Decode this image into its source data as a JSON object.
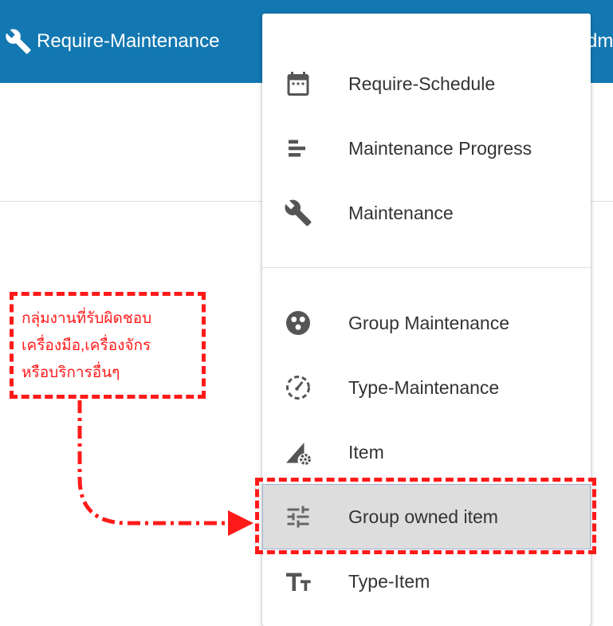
{
  "header": {
    "title": "Require-Maintenance",
    "title_icon": "wrench-icon",
    "user_label_fragment": "dm",
    "bg_color": "#1378b1"
  },
  "menu": {
    "items": [
      {
        "label": "Require-Schedule",
        "icon": "calendar-icon"
      },
      {
        "label": "Maintenance Progress",
        "icon": "bar-list-icon"
      },
      {
        "label": "Maintenance",
        "icon": "wrench-icon"
      },
      {
        "label": "Group Maintenance",
        "icon": "group-icon"
      },
      {
        "label": "Type-Maintenance",
        "icon": "dashed-gauge-icon"
      },
      {
        "label": "Item",
        "icon": "ruler-gear-icon"
      },
      {
        "label": "Group owned item",
        "icon": "sliders-icon",
        "selected": true
      },
      {
        "label": "Type-Item",
        "icon": "text-size-icon"
      }
    ]
  },
  "annotation": {
    "lines": [
      "กลุ่มงานที่รับผิดชอบ",
      "เครื่องมือ,เครื่องจักร",
      "หรือบริการอื่นๆ"
    ],
    "color": "#ff1a1a"
  }
}
